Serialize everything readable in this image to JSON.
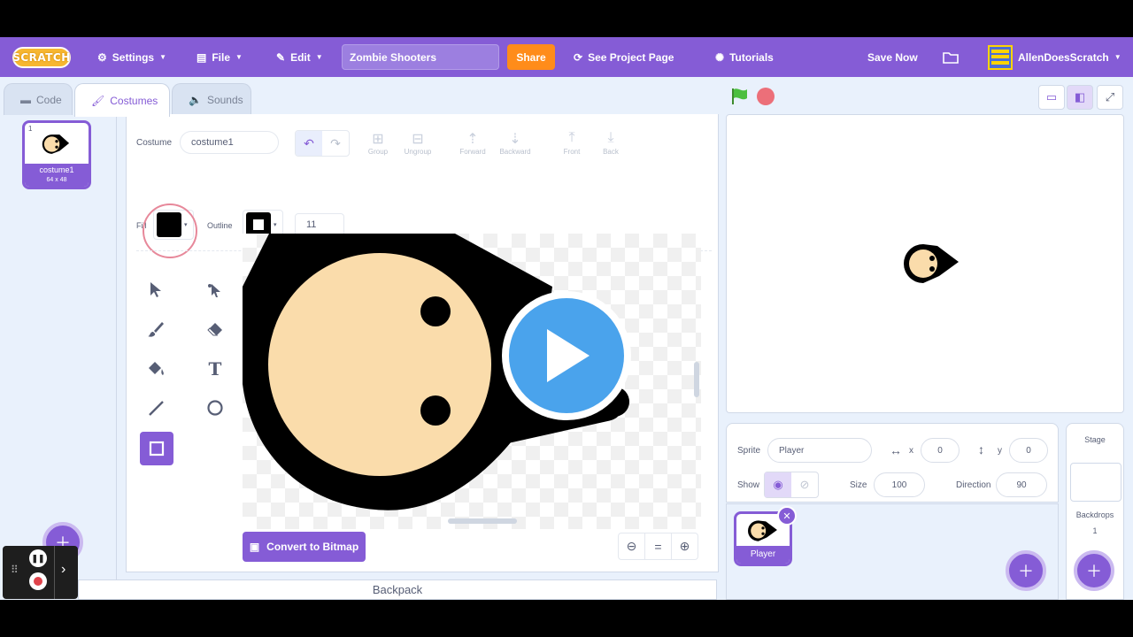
{
  "menubar": {
    "logo": "SCRATCH",
    "settings": "Settings",
    "file": "File",
    "edit": "Edit",
    "project_title": "Zombie Shooters",
    "share": "Share",
    "see_project_page": "See Project Page",
    "tutorials": "Tutorials",
    "save_now": "Save Now",
    "username": "AllenDoesScratch"
  },
  "tabs": {
    "code": "Code",
    "costumes": "Costumes",
    "sounds": "Sounds"
  },
  "costume_list": [
    {
      "number": "1",
      "name": "costume1",
      "size": "64 x 48"
    }
  ],
  "editor": {
    "costume_label": "Costume",
    "costume_name": "costume1",
    "tools": {
      "group": "Group",
      "ungroup": "Ungroup",
      "forward": "Forward",
      "backward": "Backward",
      "front": "Front",
      "back": "Back"
    },
    "fill_label": "Fill",
    "outline_label": "Outline",
    "outline_width": "11",
    "convert_button": "Convert to Bitmap",
    "zoom_reset": "="
  },
  "backpack": "Backpack",
  "sprite_info": {
    "sprite_label": "Sprite",
    "sprite_name": "Player",
    "x_label": "x",
    "x_value": "0",
    "y_label": "y",
    "y_value": "0",
    "show_label": "Show",
    "size_label": "Size",
    "size_value": "100",
    "direction_label": "Direction",
    "direction_value": "90"
  },
  "sprites": [
    {
      "name": "Player"
    }
  ],
  "stage_pane": {
    "title": "Stage",
    "backdrops_label": "Backdrops",
    "backdrops_count": "1"
  },
  "colors": {
    "accent": "#855cd6",
    "share": "#ff8c1a",
    "skin": "#fadcab"
  }
}
